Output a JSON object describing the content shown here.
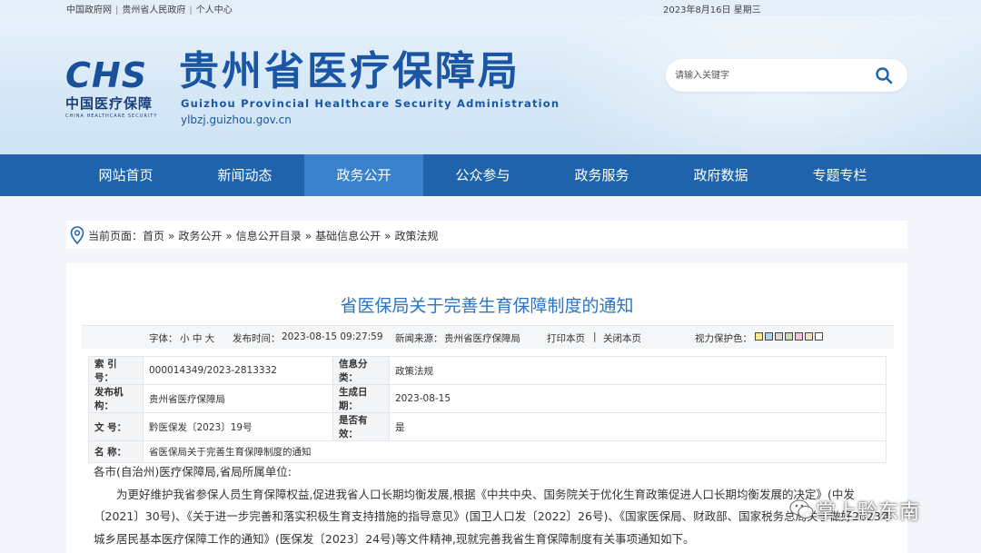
{
  "topbar": {
    "links": [
      "中国政府网",
      "贵州省人民政府",
      "个人中心"
    ],
    "date": "2023年8月16日 星期三"
  },
  "header": {
    "logo_mark": "CHS",
    "logo_cn": "中国医疗保障",
    "logo_en": "CHINA HEALTHCARE SECURITY",
    "title": "贵州省医疗保障局",
    "title_en": "Guizhou Provincial Healthcare Security Administration",
    "url": "ylbzj.guizhou.gov.cn",
    "search_placeholder": "请输入关键字"
  },
  "nav": {
    "items": [
      "网站首页",
      "新闻动态",
      "政务公开",
      "公众参与",
      "政务服务",
      "政府数据",
      "专题专栏"
    ],
    "active": "政务公开"
  },
  "breadcrumb": {
    "prefix": "当前页面：",
    "items": [
      "首页",
      "政务公开",
      "信息公开目录",
      "基础信息公开",
      "政策法规"
    ],
    "separator": "»"
  },
  "article": {
    "title": "省医保局关于完善生育保障制度的通知",
    "meta": {
      "font_label": "字体：",
      "font_sizes": "小 中 大",
      "time_label": "发布时间：",
      "time": "2023-08-15 09:27:59",
      "source_label": "新闻来源：",
      "source": "贵州省医疗保障局",
      "print": "打印本页",
      "close": "关闭本页",
      "vision_label": "视力保护色：",
      "vision_colors": [
        "#f7e98f",
        "#a9d6ef",
        "#d8d8d8",
        "#c8ddb0",
        "#f1c6d6",
        "#f7e1c0",
        "#ffffff"
      ]
    },
    "info": {
      "index_label": "索 引 号：",
      "index": "000014349/2023-2813332",
      "category_label": "信息分类：",
      "category": "政策法规",
      "issuer_label": "发布机构：",
      "issuer": "贵州省医疗保障局",
      "date_label": "生成日期：",
      "date": "2023-08-15",
      "docno_label": "文 号：",
      "docno": "黔医保发〔2023〕19号",
      "valid_label": "是否有效：",
      "valid": "是",
      "name_label": "名 称：",
      "name": "省医保局关于完善生育保障制度的通知"
    },
    "body": {
      "salutation": "各市(自治州)医疗保障局,省局所属单位:",
      "para1": "为更好维护我省参保人员生育保障权益,促进我省人口长期均衡发展,根据《中共中央、国务院关于优化生育政策促进人口长期均衡发展的决定》(中发〔2021〕30号)、《关于进一步完善和落实积极生育支持措施的指导意见》(国卫人口发〔2022〕26号)、《国家医保局、财政部、国家税务总局关于做好2023年城乡居民基本医疗保障工作的通知》(医保发〔2023〕24号)等文件精神,现就完善我省生育保障制度有关事项通知如下。"
    }
  },
  "watermark": {
    "text": "掌上黔东南"
  }
}
